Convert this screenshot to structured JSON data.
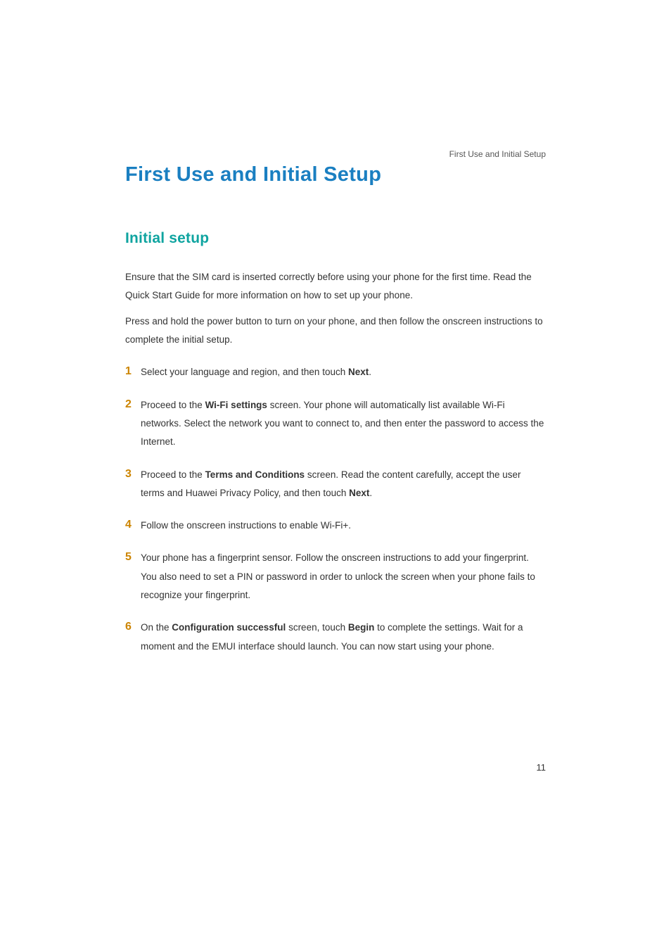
{
  "header_label": "First Use and Initial Setup",
  "title": "First Use and Initial Setup",
  "section_title": "Initial setup",
  "para1": "Ensure that the SIM card is inserted correctly before using your phone for the first time. Read the Quick Start Guide for more information on how to set up your phone.",
  "para2": "Press and hold the power button to turn on your phone, and then follow the onscreen instructions to complete the initial setup.",
  "items": {
    "n1": "1",
    "t1a": "Select your language and region, and then touch ",
    "t1b": "Next",
    "t1c": ".",
    "n2": "2",
    "t2a": "Proceed to the ",
    "t2b": "Wi-Fi settings",
    "t2c": " screen. Your phone will automatically list available Wi-Fi networks. Select the network you want to connect to, and then enter the password to access the Internet.",
    "n3": "3",
    "t3a": "Proceed to the ",
    "t3b": "Terms and Conditions",
    "t3c": " screen. Read the content carefully, accept the user terms and Huawei Privacy Policy, and then touch ",
    "t3d": "Next",
    "t3e": ".",
    "n4": "4",
    "t4a": "Follow the onscreen instructions to enable Wi-Fi+.",
    "n5": "5",
    "t5a": "Your phone has a fingerprint sensor. Follow the onscreen instructions to add your fingerprint. You also need to set a PIN or password in order to unlock the screen when your phone fails to recognize your fingerprint.",
    "n6": "6",
    "t6a": "On the ",
    "t6b": "Configuration successful",
    "t6c": " screen, touch ",
    "t6d": "Begin",
    "t6e": " to complete the settings. Wait for a moment and the EMUI interface should launch. You can now start using your phone."
  },
  "page_number": "11",
  "colors": {
    "title_blue": "#1a7fc1",
    "section_teal": "#0fa4a0",
    "num_orange": "#cc8400"
  }
}
